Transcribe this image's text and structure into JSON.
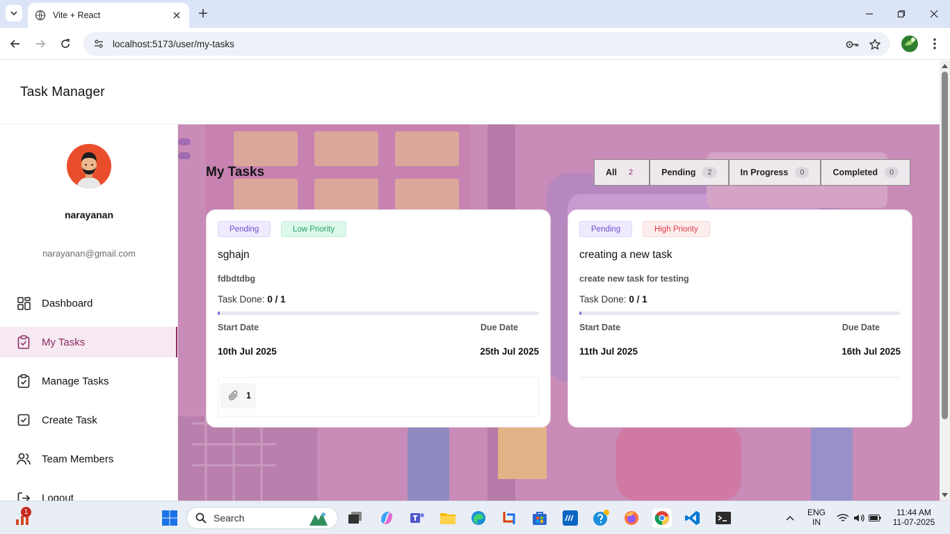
{
  "browser": {
    "tab_title": "Vite + React",
    "url": "localhost:5173/user/my-tasks"
  },
  "app": {
    "title": "Task Manager"
  },
  "user": {
    "name": "narayanan",
    "email": "narayanan@gmail.com"
  },
  "sidebar": {
    "items": [
      {
        "label": "Dashboard",
        "icon": "dashboard-icon"
      },
      {
        "label": "My Tasks",
        "icon": "clipboard-check-icon",
        "active": true
      },
      {
        "label": "Manage Tasks",
        "icon": "clipboard-check-icon"
      },
      {
        "label": "Create Task",
        "icon": "square-check-icon"
      },
      {
        "label": "Team Members",
        "icon": "users-icon"
      },
      {
        "label": "Logout",
        "icon": "logout-icon"
      }
    ]
  },
  "main": {
    "page_title": "My Tasks",
    "filters": [
      {
        "label": "All",
        "count": "2",
        "active": true
      },
      {
        "label": "Pending",
        "count": "2"
      },
      {
        "label": "In Progress",
        "count": "0"
      },
      {
        "label": "Completed",
        "count": "0"
      }
    ],
    "tasks": [
      {
        "status": "Pending",
        "priority": "Low Priority",
        "title": "sghajn",
        "description": "fdbdtdbg",
        "done_label": "Task Done:",
        "done_value": "0 / 1",
        "progress": 0.0,
        "start_label": "Start Date",
        "due_label": "Due Date",
        "start_date": "10th Jul 2025",
        "due_date": "25th Jul 2025",
        "attachments": "1"
      },
      {
        "status": "Pending",
        "priority": "High Priority",
        "title": "creating a new task",
        "description": "create new task for testing",
        "done_label": "Task Done:",
        "done_value": "0 / 1",
        "progress": 0.0,
        "start_label": "Start Date",
        "due_label": "Due Date",
        "start_date": "11th Jul 2025",
        "due_date": "16th Jul 2025"
      }
    ]
  },
  "taskbar": {
    "search_placeholder": "Search",
    "notification_count": "1",
    "language": "ENG",
    "region": "IN",
    "time": "11:44 AM",
    "date": "11-07-2025"
  },
  "colors": {
    "accent": "#8c2a62",
    "main_background": "#c88ab7",
    "pending": "#6c4fd1",
    "low_priority": "#24a264",
    "high_priority": "#e0354a"
  }
}
